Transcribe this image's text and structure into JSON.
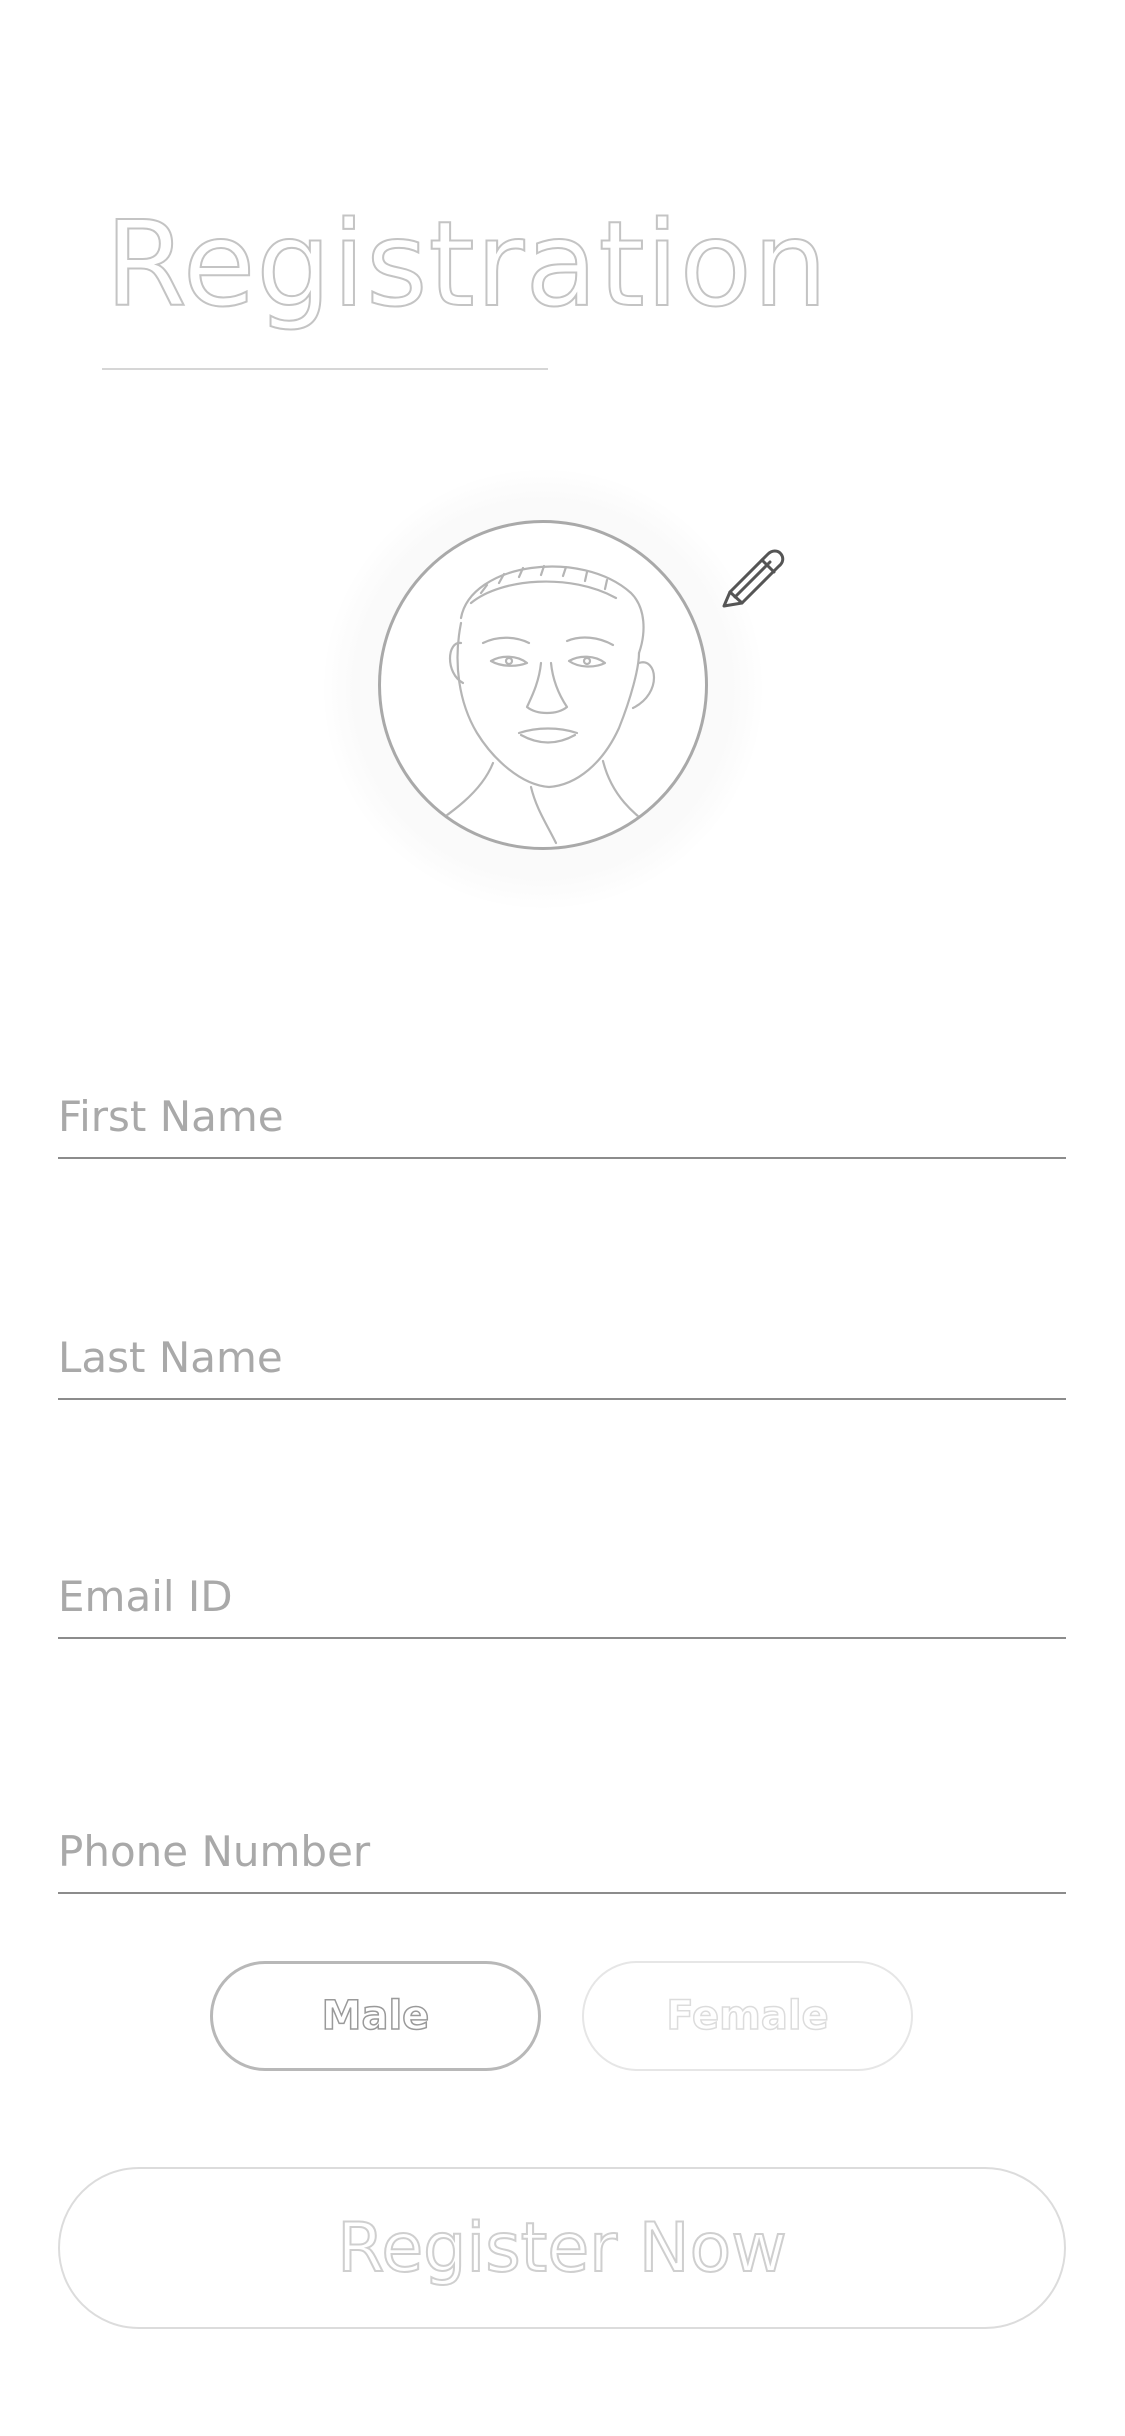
{
  "header": {
    "title": "Registration"
  },
  "profile": {
    "avatar_icon": "person-photo",
    "edit_icon": "pencil-icon"
  },
  "form": {
    "first_name": {
      "placeholder": "First Name",
      "value": ""
    },
    "last_name": {
      "placeholder": "Last Name",
      "value": ""
    },
    "email": {
      "placeholder": "Email ID",
      "value": ""
    },
    "phone": {
      "placeholder": "Phone Number",
      "value": ""
    }
  },
  "gender": {
    "male_label": "Male",
    "female_label": "Female",
    "selected": "Male"
  },
  "actions": {
    "register_label": "Register Now"
  },
  "colors": {
    "line": "#8c8c8c",
    "placeholder": "#a9a9a9",
    "outline": "#c4c4c4"
  }
}
